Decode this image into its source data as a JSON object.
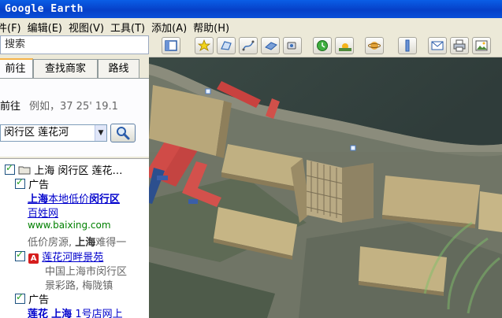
{
  "window": {
    "title": "Google Earth"
  },
  "menu": [
    "件(F)",
    "编辑(E)",
    "视图(V)",
    "工具(T)",
    "添加(A)",
    "帮助(H)"
  ],
  "search_panel": {
    "header": "搜索",
    "tabs": [
      "前往",
      "查找商家",
      "路线"
    ],
    "goto_label": "前往",
    "example": "例如，37 25' 19.1",
    "selected_location": "闵行区 莲花河"
  },
  "results": {
    "root_label": "上海 闵行区 莲花…",
    "ad1": {
      "label": "广告",
      "title_part1": "上海",
      "title_part2": "本地低价",
      "title_part3": "闵行区",
      "title_line2": "百姓网",
      "url": "www.baixing.com",
      "desc_part1": "低价房源, ",
      "desc_part2": "上海",
      "desc_part3": "难得一"
    },
    "place": {
      "marker": "A",
      "name": "莲花河畔景苑",
      "addr1": "中国上海市闵行区",
      "addr2": "景彩路, 梅陇镇"
    },
    "ad2": {
      "label": "广告",
      "title_part1": "莲花",
      "title_part2": "上海",
      "title_part3": "1号店网上"
    }
  },
  "toolbar": {
    "buttons": [
      "sidebar-toggle-icon",
      "placemark-icon",
      "polygon-icon",
      "path-icon",
      "image-overlay-icon",
      "record-tour-icon",
      "historical-imagery-icon",
      "sunlight-icon",
      "planets-icon",
      "ruler-icon",
      "email-icon",
      "print-icon",
      "save-image-icon"
    ]
  },
  "colors": {
    "title_bar": "#0a5ee6",
    "link": "#0000cc",
    "url_green": "#008000",
    "marker_red": "#d61d1d"
  }
}
